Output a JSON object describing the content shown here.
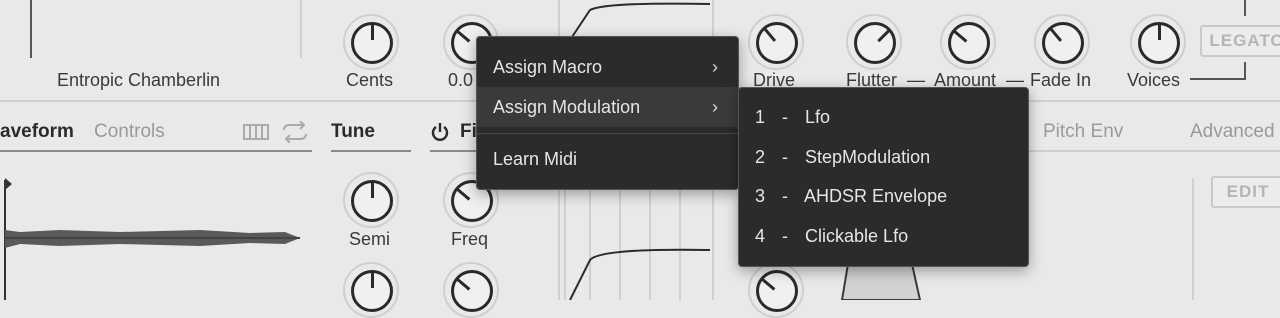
{
  "preset": {
    "name": "Entropic Chamberlin"
  },
  "top_labels": {
    "cents": "Cents",
    "zero": "0.0",
    "drive": "Drive",
    "flutter": "Flutter",
    "amount": "Amount",
    "fade_in": "Fade In",
    "voices": "Voices",
    "legato": "LEGATO",
    "dash1": "—",
    "dash2": "—"
  },
  "tabs": {
    "waveform": "aveform",
    "controls": "Controls",
    "tune": "Tune",
    "filter_partial": "Fi",
    "pitch_env": "Pitch Env",
    "advanced": "Advanced"
  },
  "tune_labels": {
    "semi": "Semi",
    "freq": "Freq"
  },
  "buttons": {
    "edit": "EDIT"
  },
  "context_menu": {
    "items": [
      {
        "label": "Assign Macro",
        "arrow": "›"
      },
      {
        "label": "Assign Modulation",
        "arrow": "›"
      },
      {
        "label": "Learn Midi"
      }
    ]
  },
  "submenu": {
    "items": [
      {
        "num": "1",
        "sep": "-",
        "label": "Lfo"
      },
      {
        "num": "2",
        "sep": "-",
        "label": "StepModulation"
      },
      {
        "num": "3",
        "sep": "-",
        "label": "AHDSR Envelope"
      },
      {
        "num": "4",
        "sep": "-",
        "label": "Clickable Lfo"
      }
    ]
  },
  "icons": {
    "keyboard": "keyboard-icon",
    "loop": "loop-icon",
    "power": "power-icon",
    "marker": "playhead-marker-icon"
  }
}
